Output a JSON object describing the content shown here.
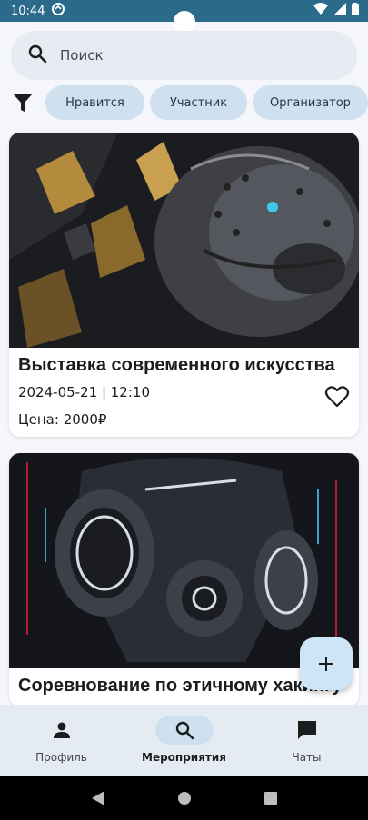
{
  "status_bar": {
    "time": "10:44"
  },
  "search": {
    "placeholder": "Поиск"
  },
  "filters": {
    "chips": [
      "Нравится",
      "Участник",
      "Организатор"
    ]
  },
  "events": [
    {
      "title": "Выставка современного искусства",
      "datetime": "2024-05-21 | 12:10",
      "price": "Цена: 2000₽"
    },
    {
      "title": "Соревнование по этичному хакингу"
    }
  ],
  "bottom_nav": {
    "items": [
      {
        "label": "Профиль",
        "icon": "person-icon"
      },
      {
        "label": "Мероприятия",
        "icon": "search-icon"
      },
      {
        "label": "Чаты",
        "icon": "chat-icon"
      }
    ],
    "active_index": 1
  },
  "colors": {
    "status_bar": "#2c6a8c",
    "chip_bg": "#cfe0ee",
    "fab_bg": "#cde5f7",
    "nav_bg": "#e4ebf3"
  }
}
